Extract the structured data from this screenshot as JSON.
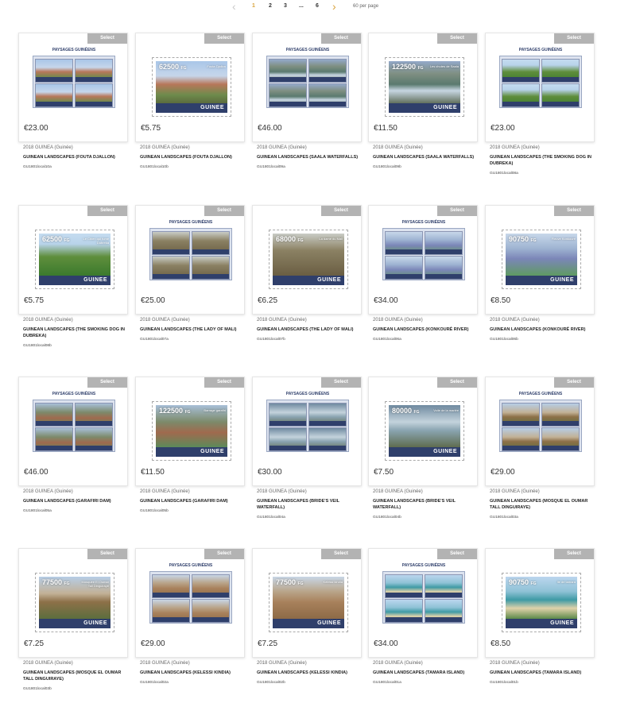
{
  "pagination": {
    "prev_icon": "chevron-left-icon",
    "next_icon": "chevron-right-icon",
    "pages": [
      "1",
      "2",
      "3",
      "...",
      "6"
    ],
    "active_page": "1",
    "per_page_label": "60 per page"
  },
  "select_label": "Select",
  "colors": {
    "accent": "#d9a33c",
    "select_button": "#b3b3b3",
    "stamp_band": "#2f3f6b"
  },
  "products": [
    {
      "type": "sheet",
      "sheet_title": "PAYSAGES GUINÉENS",
      "theme": "sky-mount",
      "price": "€23.00",
      "series": "2018 GUINEA (Guinée)",
      "name": "GUINEAN LANDSCAPES (FOUTA DJALLON)",
      "code": "GU1801local10a"
    },
    {
      "type": "stamp",
      "denomination": "62500",
      "currency": "FG",
      "stamp_caption": "Fouta Djallon",
      "country_text": "GUINEE",
      "theme": "sky-mount",
      "price": "€5.75",
      "series": "2018 GUINEA (Guinée)",
      "name": "GUINEAN LANDSCAPES (FOUTA DJALLON)",
      "code": "GU1801local10b"
    },
    {
      "type": "sheet",
      "sheet_title": "PAYSAGES GUINÉENS",
      "theme": "sky-fall",
      "price": "€46.00",
      "series": "2018 GUINEA (Guinée)",
      "name": "GUINEAN LANDSCAPES (SAALA WATERFALLS)",
      "code": "GU1801local09a"
    },
    {
      "type": "stamp",
      "denomination": "122500",
      "currency": "FG",
      "stamp_caption": "Les chutes de Saala",
      "country_text": "GUINEE",
      "theme": "sky-fall",
      "price": "€11.50",
      "series": "2018 GUINEA (Guinée)",
      "name": "GUINEAN LANDSCAPES (SAALA WATERFALLS)",
      "code": "GU1801local09b"
    },
    {
      "type": "sheet",
      "sheet_title": "PAYSAGES GUINÉENS",
      "theme": "sky-green",
      "price": "€23.00",
      "series": "2018 GUINEA (Guinée)",
      "name": "GUINEAN LANDSCAPES (THE SMOKING DOG IN DUBREKA)",
      "code": "GU1801local08a"
    },
    {
      "type": "stamp",
      "denomination": "62500",
      "currency": "FG",
      "stamp_caption": "Le Chien qui fume Dubreka",
      "country_text": "GUINEE",
      "theme": "sky-green",
      "price": "€5.75",
      "series": "2018 GUINEA (Guinée)",
      "name": "GUINEAN LANDSCAPES (THE SMOKING DOG IN DUBREKA)",
      "code": "GU1801local08b"
    },
    {
      "type": "sheet",
      "sheet_title": "PAYSAGES GUINÉENS",
      "theme": "sky-lady",
      "price": "€25.00",
      "series": "2018 GUINEA (Guinée)",
      "name": "GUINEAN LANDSCAPES (THE LADY OF MALI)",
      "code": "GU1801local07a"
    },
    {
      "type": "stamp",
      "denomination": "68000",
      "currency": "FG",
      "stamp_caption": "La dame du Mali",
      "country_text": "GUINEE",
      "theme": "sky-lady",
      "price": "€6.25",
      "series": "2018 GUINEA (Guinée)",
      "name": "GUINEAN LANDSCAPES (THE LADY OF MALI)",
      "code": "GU1801local07b"
    },
    {
      "type": "sheet",
      "sheet_title": "PAYSAGES GUINÉENS",
      "theme": "sky-river",
      "price": "€34.00",
      "series": "2018 GUINEA (Guinée)",
      "name": "GUINEAN LANDSCAPES (KONKOURÉ RIVER)",
      "code": "GU1801local06a"
    },
    {
      "type": "stamp",
      "denomination": "90750",
      "currency": "FG",
      "stamp_caption": "Fleuve Konkouré",
      "country_text": "GUINEE",
      "theme": "sky-river",
      "price": "€8.50",
      "series": "2018 GUINEA (Guinée)",
      "name": "GUINEAN LANDSCAPES (KONKOURÉ RIVER)",
      "code": "GU1801local06b"
    },
    {
      "type": "sheet",
      "sheet_title": "PAYSAGES GUINÉENS",
      "theme": "sky-dam",
      "price": "€46.00",
      "series": "2018 GUINEA (Guinée)",
      "name": "GUINEAN LANDSCAPES (GARAFIRI DAM)",
      "code": "GU1801local05a"
    },
    {
      "type": "stamp",
      "denomination": "122500",
      "currency": "FG",
      "stamp_caption": "Barrage garafiri",
      "country_text": "GUINEE",
      "theme": "sky-dam",
      "price": "€11.50",
      "series": "2018 GUINEA (Guinée)",
      "name": "GUINEAN LANDSCAPES (GARAFIRI DAM)",
      "code": "GU1801local05b"
    },
    {
      "type": "sheet",
      "sheet_title": "PAYSAGES GUINÉENS",
      "theme": "sky-veil",
      "price": "€30.00",
      "series": "2018 GUINEA (Guinée)",
      "name": "GUINEAN LANDSCAPES (BRIDE'S VEIL WATERFALL)",
      "code": "GU1801local04a"
    },
    {
      "type": "stamp",
      "denomination": "80000",
      "currency": "FG",
      "stamp_caption": "Voile de la mariée",
      "country_text": "GUINEE",
      "theme": "sky-veil",
      "price": "€7.50",
      "series": "2018 GUINEA (Guinée)",
      "name": "GUINEAN LANDSCAPES (BRIDE'S VEIL WATERFALL)",
      "code": "GU1801local04b"
    },
    {
      "type": "sheet",
      "sheet_title": "PAYSAGES GUINÉENS",
      "theme": "sky-mosque",
      "price": "€29.00",
      "series": "2018 GUINEA (Guinée)",
      "name": "GUINEAN LANDSCAPES (MOSQUE EL OUMAR TALL DINGUIRAYE)",
      "code": "GU1801local03a"
    },
    {
      "type": "stamp",
      "denomination": "77500",
      "currency": "FG",
      "stamp_caption": "Mosquée El Oumar Tall Dinguiraye",
      "country_text": "GUINEE",
      "theme": "sky-mosque",
      "price": "€7.25",
      "series": "2018 GUINEA (Guinée)",
      "name": "GUINEAN LANDSCAPES (MOSQUE EL OUMAR TALL DINGUIRAYE)",
      "code": "GU1801local03b"
    },
    {
      "type": "sheet",
      "sheet_title": "PAYSAGES GUINÉENS",
      "theme": "sky-kelessi",
      "price": "€29.00",
      "series": "2018 GUINEA (Guinée)",
      "name": "GUINEAN LANDSCAPES (KELESSI KINDIA)",
      "code": "GU1801local02a"
    },
    {
      "type": "stamp",
      "denomination": "77500",
      "currency": "FG",
      "stamp_caption": "Kelessi kindia",
      "country_text": "GUINEE",
      "theme": "sky-kelessi",
      "price": "€7.25",
      "series": "2018 GUINEA (Guinée)",
      "name": "GUINEAN LANDSCAPES (KELESSI KINDIA)",
      "code": "GU1801local02b"
    },
    {
      "type": "sheet",
      "sheet_title": "PAYSAGES GUINÉENS",
      "theme": "sky-tamara",
      "price": "€34.00",
      "series": "2018 GUINEA (Guinée)",
      "name": "GUINEAN LANDSCAPES (TAMARA ISLAND)",
      "code": "GU1801local01a"
    },
    {
      "type": "stamp",
      "denomination": "90750",
      "currency": "FG",
      "stamp_caption": "Ile de tamara",
      "country_text": "GUINEE",
      "theme": "sky-tamara",
      "price": "€8.50",
      "series": "2018 GUINEA (Guinée)",
      "name": "GUINEAN LANDSCAPES (TAMARA ISLAND)",
      "code": "GU1801local01b"
    }
  ]
}
